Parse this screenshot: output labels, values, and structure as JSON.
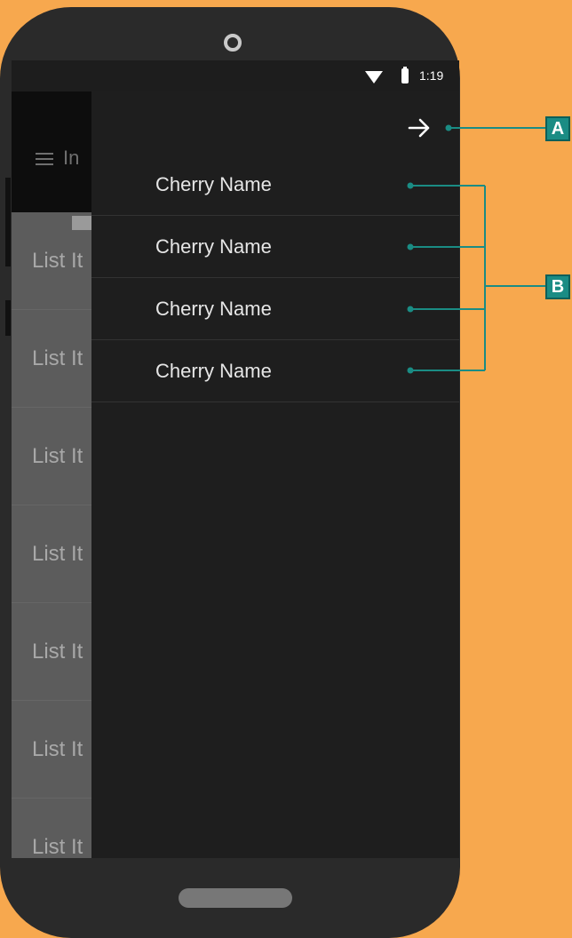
{
  "status_bar": {
    "time": "1:19"
  },
  "app": {
    "title_partial": "In",
    "list_items": [
      "List It",
      "List It",
      "List It",
      "List It",
      "List It",
      "List It",
      "List It"
    ]
  },
  "drawer": {
    "items": [
      {
        "label": "Cherry Name"
      },
      {
        "label": "Cherry Name"
      },
      {
        "label": "Cherry Name"
      },
      {
        "label": "Cherry Name"
      }
    ]
  },
  "annotations": {
    "a": "A",
    "b": "B"
  },
  "colors": {
    "background": "#F7A84E",
    "phone_body": "#2A2A2A",
    "drawer": "#1E1E1E",
    "annotation": "#1A8C84"
  },
  "icons": [
    "wifi-icon",
    "battery-icon",
    "menu-icon",
    "mail-icon",
    "arrow-right-icon"
  ]
}
